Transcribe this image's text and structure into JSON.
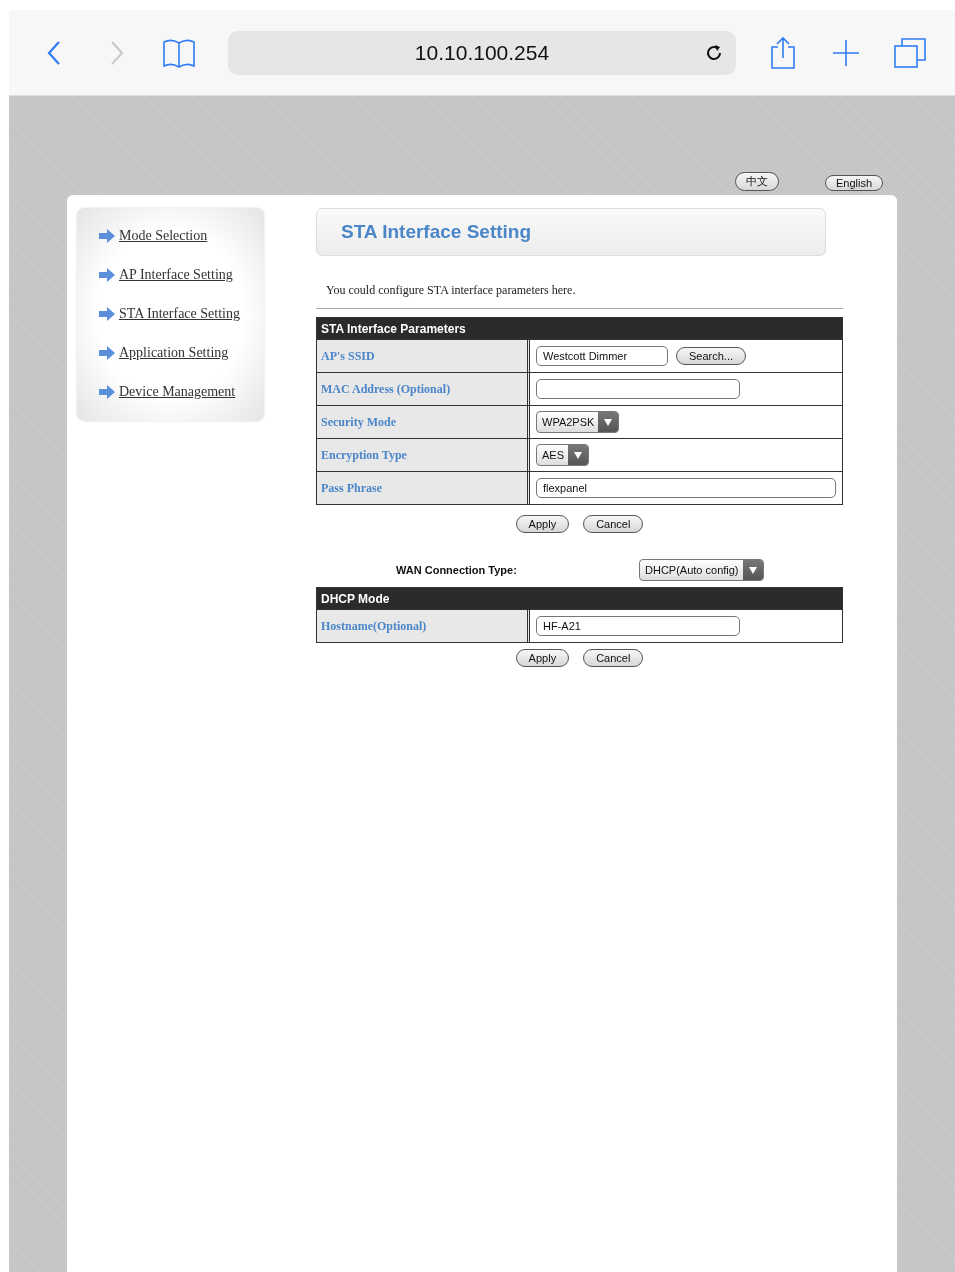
{
  "browser": {
    "address": "10.10.100.254"
  },
  "languages": [
    {
      "label": "中文"
    },
    {
      "label": "English"
    }
  ],
  "sidebar": {
    "items": [
      {
        "label": "Mode Selection"
      },
      {
        "label": "AP Interface Setting"
      },
      {
        "label": "STA Interface Setting"
      },
      {
        "label": "Application Setting"
      },
      {
        "label": "Device Management"
      }
    ]
  },
  "title": "STA Interface Setting",
  "description": "You could configure STA interface parameters here.",
  "sta_table": {
    "header": "STA Interface Parameters",
    "rows": [
      {
        "label": "AP's SSID",
        "kind": "text",
        "value": "Westcott Dimmer",
        "button": "Search..."
      },
      {
        "label": "MAC Address (Optional)",
        "kind": "text"
      },
      {
        "label": "Security Mode",
        "kind": "select",
        "value": "WPA2PSK"
      },
      {
        "label": "Encryption Type",
        "kind": "select",
        "value": "AES"
      },
      {
        "label": "Pass Phrase",
        "kind": "wide",
        "value": "flexpanel"
      }
    ]
  },
  "sta_buttons": [
    "Apply",
    "Cancel"
  ],
  "wan": {
    "label": "WAN Connection Type:",
    "value": "DHCP(Auto config)"
  },
  "dhcp_table": {
    "header": "DHCP Mode",
    "rows": [
      {
        "label": "Hostname(Optional)",
        "kind": "text",
        "value": "HF-A21"
      }
    ]
  },
  "dhcp_buttons": [
    "Apply",
    "Cancel"
  ]
}
